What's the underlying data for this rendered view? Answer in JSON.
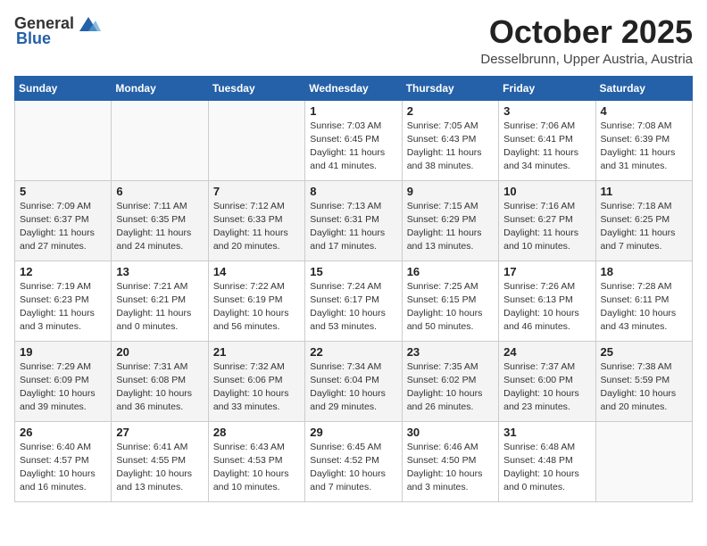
{
  "header": {
    "logo_general": "General",
    "logo_blue": "Blue",
    "month": "October 2025",
    "location": "Desselbrunn, Upper Austria, Austria"
  },
  "weekdays": [
    "Sunday",
    "Monday",
    "Tuesday",
    "Wednesday",
    "Thursday",
    "Friday",
    "Saturday"
  ],
  "weeks": [
    [
      {
        "day": "",
        "info": ""
      },
      {
        "day": "",
        "info": ""
      },
      {
        "day": "",
        "info": ""
      },
      {
        "day": "1",
        "info": "Sunrise: 7:03 AM\nSunset: 6:45 PM\nDaylight: 11 hours\nand 41 minutes."
      },
      {
        "day": "2",
        "info": "Sunrise: 7:05 AM\nSunset: 6:43 PM\nDaylight: 11 hours\nand 38 minutes."
      },
      {
        "day": "3",
        "info": "Sunrise: 7:06 AM\nSunset: 6:41 PM\nDaylight: 11 hours\nand 34 minutes."
      },
      {
        "day": "4",
        "info": "Sunrise: 7:08 AM\nSunset: 6:39 PM\nDaylight: 11 hours\nand 31 minutes."
      }
    ],
    [
      {
        "day": "5",
        "info": "Sunrise: 7:09 AM\nSunset: 6:37 PM\nDaylight: 11 hours\nand 27 minutes."
      },
      {
        "day": "6",
        "info": "Sunrise: 7:11 AM\nSunset: 6:35 PM\nDaylight: 11 hours\nand 24 minutes."
      },
      {
        "day": "7",
        "info": "Sunrise: 7:12 AM\nSunset: 6:33 PM\nDaylight: 11 hours\nand 20 minutes."
      },
      {
        "day": "8",
        "info": "Sunrise: 7:13 AM\nSunset: 6:31 PM\nDaylight: 11 hours\nand 17 minutes."
      },
      {
        "day": "9",
        "info": "Sunrise: 7:15 AM\nSunset: 6:29 PM\nDaylight: 11 hours\nand 13 minutes."
      },
      {
        "day": "10",
        "info": "Sunrise: 7:16 AM\nSunset: 6:27 PM\nDaylight: 11 hours\nand 10 minutes."
      },
      {
        "day": "11",
        "info": "Sunrise: 7:18 AM\nSunset: 6:25 PM\nDaylight: 11 hours\nand 7 minutes."
      }
    ],
    [
      {
        "day": "12",
        "info": "Sunrise: 7:19 AM\nSunset: 6:23 PM\nDaylight: 11 hours\nand 3 minutes."
      },
      {
        "day": "13",
        "info": "Sunrise: 7:21 AM\nSunset: 6:21 PM\nDaylight: 11 hours\nand 0 minutes."
      },
      {
        "day": "14",
        "info": "Sunrise: 7:22 AM\nSunset: 6:19 PM\nDaylight: 10 hours\nand 56 minutes."
      },
      {
        "day": "15",
        "info": "Sunrise: 7:24 AM\nSunset: 6:17 PM\nDaylight: 10 hours\nand 53 minutes."
      },
      {
        "day": "16",
        "info": "Sunrise: 7:25 AM\nSunset: 6:15 PM\nDaylight: 10 hours\nand 50 minutes."
      },
      {
        "day": "17",
        "info": "Sunrise: 7:26 AM\nSunset: 6:13 PM\nDaylight: 10 hours\nand 46 minutes."
      },
      {
        "day": "18",
        "info": "Sunrise: 7:28 AM\nSunset: 6:11 PM\nDaylight: 10 hours\nand 43 minutes."
      }
    ],
    [
      {
        "day": "19",
        "info": "Sunrise: 7:29 AM\nSunset: 6:09 PM\nDaylight: 10 hours\nand 39 minutes."
      },
      {
        "day": "20",
        "info": "Sunrise: 7:31 AM\nSunset: 6:08 PM\nDaylight: 10 hours\nand 36 minutes."
      },
      {
        "day": "21",
        "info": "Sunrise: 7:32 AM\nSunset: 6:06 PM\nDaylight: 10 hours\nand 33 minutes."
      },
      {
        "day": "22",
        "info": "Sunrise: 7:34 AM\nSunset: 6:04 PM\nDaylight: 10 hours\nand 29 minutes."
      },
      {
        "day": "23",
        "info": "Sunrise: 7:35 AM\nSunset: 6:02 PM\nDaylight: 10 hours\nand 26 minutes."
      },
      {
        "day": "24",
        "info": "Sunrise: 7:37 AM\nSunset: 6:00 PM\nDaylight: 10 hours\nand 23 minutes."
      },
      {
        "day": "25",
        "info": "Sunrise: 7:38 AM\nSunset: 5:59 PM\nDaylight: 10 hours\nand 20 minutes."
      }
    ],
    [
      {
        "day": "26",
        "info": "Sunrise: 6:40 AM\nSunset: 4:57 PM\nDaylight: 10 hours\nand 16 minutes."
      },
      {
        "day": "27",
        "info": "Sunrise: 6:41 AM\nSunset: 4:55 PM\nDaylight: 10 hours\nand 13 minutes."
      },
      {
        "day": "28",
        "info": "Sunrise: 6:43 AM\nSunset: 4:53 PM\nDaylight: 10 hours\nand 10 minutes."
      },
      {
        "day": "29",
        "info": "Sunrise: 6:45 AM\nSunset: 4:52 PM\nDaylight: 10 hours\nand 7 minutes."
      },
      {
        "day": "30",
        "info": "Sunrise: 6:46 AM\nSunset: 4:50 PM\nDaylight: 10 hours\nand 3 minutes."
      },
      {
        "day": "31",
        "info": "Sunrise: 6:48 AM\nSunset: 4:48 PM\nDaylight: 10 hours\nand 0 minutes."
      },
      {
        "day": "",
        "info": ""
      }
    ]
  ]
}
